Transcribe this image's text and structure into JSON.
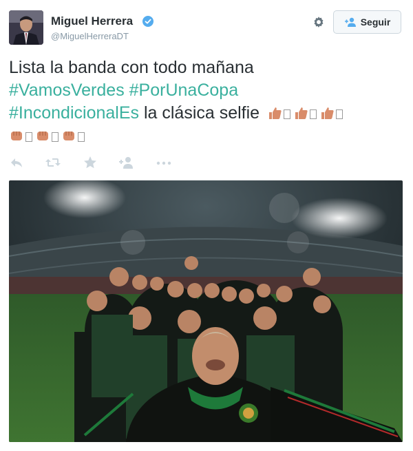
{
  "user": {
    "name": "Miguel Herrera",
    "handle": "@MiguelHerreraDT",
    "verified": true
  },
  "follow_button": {
    "label": "Seguir"
  },
  "tweet": {
    "line1": "Lista la banda con todo mañana",
    "hashtag1": "#VamosVerdes",
    "hashtag2": "#PorUnaCopa",
    "hashtag3": "#IncondicionalEs",
    "line3_rest": " la clásica selfie"
  },
  "icons": {
    "verified": "verified-badge-icon",
    "settings": "gear-icon",
    "follow": "add-user-icon",
    "reply": "reply-icon",
    "retweet": "retweet-icon",
    "favorite": "star-icon",
    "follow_action": "add-user-icon",
    "more": "more-icon"
  },
  "colors": {
    "hashtag": "#3ab09e",
    "text": "#292f33",
    "muted": "#8899a6",
    "verified": "#55acee",
    "action_icon": "#ccd6dd",
    "emoji_skin": "#d98c6a"
  }
}
